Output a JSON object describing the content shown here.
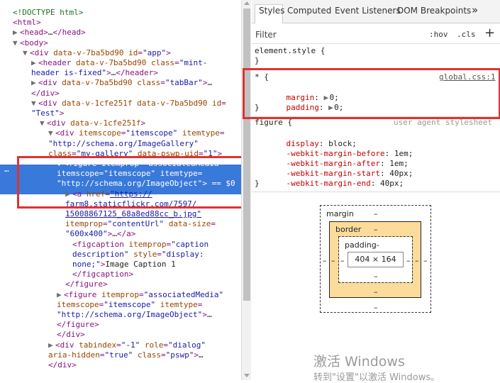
{
  "elements_tree": {
    "lines": [
      {
        "parts": [
          [
            "cmt",
            "<!DOCTYPE html>"
          ]
        ]
      },
      {
        "parts": [
          [
            "tag",
            "<html>"
          ]
        ]
      },
      {
        "parts": [
          [
            "tri",
            "▶"
          ],
          [
            "tag",
            "<head>"
          ],
          [
            "txt",
            "…"
          ],
          [
            "tag",
            "</head>"
          ]
        ]
      },
      {
        "parts": [
          [
            "tri",
            "▼"
          ],
          [
            "tag",
            "<body>"
          ]
        ]
      },
      {
        "parts": [
          [
            "tri",
            "▼"
          ],
          [
            "tag",
            "<div "
          ],
          [
            "attr",
            "data-v-7ba5bd90 id"
          ],
          [
            "tag",
            "="
          ],
          [
            "val",
            "\"app\""
          ],
          [
            "tag",
            ">"
          ]
        ]
      },
      {
        "parts": [
          [
            "tri",
            "▶"
          ],
          [
            "tag",
            "<header "
          ],
          [
            "attr",
            "data-v-7ba5bd90 class"
          ],
          [
            "tag",
            "="
          ],
          [
            "val",
            "\"mint-"
          ]
        ]
      },
      {
        "parts": [
          [
            "val",
            "header is-fixed\""
          ],
          [
            "tag",
            ">"
          ],
          [
            "txt",
            "…"
          ],
          [
            "tag",
            "</header>"
          ]
        ]
      },
      {
        "parts": [
          [
            "tri",
            "▶"
          ],
          [
            "tag",
            "<div "
          ],
          [
            "attr",
            "data-v-7ba5bd90 class"
          ],
          [
            "tag",
            "="
          ],
          [
            "val",
            "\"tabBar\""
          ],
          [
            "tag",
            ">"
          ],
          [
            "txt",
            "…"
          ]
        ]
      },
      {
        "parts": [
          [
            "tag",
            "</div>"
          ]
        ]
      },
      {
        "parts": [
          [
            "tri",
            "▼"
          ],
          [
            "tag",
            "<div "
          ],
          [
            "attr",
            "data-v-1cfe251f data-v-7ba5bd90 id"
          ],
          [
            "tag",
            "="
          ]
        ]
      },
      {
        "parts": [
          [
            "val",
            "\"Test\""
          ],
          [
            "tag",
            ">"
          ]
        ]
      },
      {
        "parts": [
          [
            "tri",
            "▼"
          ],
          [
            "tag",
            "<div "
          ],
          [
            "attr",
            "data-v-1cfe251f"
          ],
          [
            "tag",
            ">"
          ]
        ]
      },
      {
        "parts": [
          [
            "tri",
            "▼"
          ],
          [
            "tag",
            "<div "
          ],
          [
            "attr",
            "itemscope"
          ],
          [
            "tag",
            "="
          ],
          [
            "val",
            "\"itemscope\""
          ],
          [
            "attr",
            " itemtype"
          ],
          [
            "tag",
            "="
          ]
        ]
      },
      {
        "parts": [
          [
            "val",
            "\"http://schema.org/ImageGallery\""
          ]
        ]
      },
      {
        "parts": [
          [
            "attr",
            "class"
          ],
          [
            "tag",
            "="
          ],
          [
            "val",
            "\"my-gallery\""
          ],
          [
            "attr",
            " data-pswp-uid"
          ],
          [
            "tag",
            "="
          ],
          [
            "val",
            "\"1\""
          ],
          [
            "tag",
            ">"
          ]
        ]
      },
      {
        "parts": [
          [
            "tri",
            "▼"
          ],
          [
            "tag",
            "<figure "
          ],
          [
            "attr",
            "itemprop"
          ],
          [
            "tag",
            "="
          ],
          [
            "val",
            "\"associatedMedia\""
          ]
        ]
      },
      {
        "parts": [
          [
            "attr",
            "itemscope"
          ],
          [
            "tag",
            "="
          ],
          [
            "val",
            "\"itemscope\""
          ],
          [
            "attr",
            " itemtype"
          ],
          [
            "tag",
            "="
          ]
        ]
      },
      {
        "parts": [
          [
            "val",
            "\"http://schema.org/ImageObject\""
          ],
          [
            "tag",
            ">"
          ],
          [
            "txt",
            " == $0"
          ]
        ]
      },
      {
        "parts": [
          [
            "tri",
            "▶"
          ],
          [
            "tag",
            "<a "
          ],
          [
            "attr",
            "href"
          ],
          [
            "tag",
            "="
          ],
          [
            "link",
            "\"https://"
          ]
        ]
      },
      {
        "parts": [
          [
            "link",
            "farm8.staticflickr.com/7597/"
          ]
        ]
      },
      {
        "parts": [
          [
            "link",
            "15008867125_68a8ed88cc_b.jpg\""
          ]
        ]
      },
      {
        "parts": [
          [
            "attr",
            "itemprop"
          ],
          [
            "tag",
            "="
          ],
          [
            "val",
            "\"contentUrl\""
          ],
          [
            "attr",
            " data-size"
          ],
          [
            "tag",
            "="
          ]
        ]
      },
      {
        "parts": [
          [
            "val",
            "\"600x400\""
          ],
          [
            "tag",
            ">"
          ],
          [
            "txt",
            "…"
          ],
          [
            "tag",
            "</a>"
          ]
        ]
      },
      {
        "parts": [
          [
            "tag",
            "<figcaption "
          ],
          [
            "attr",
            "itemprop"
          ],
          [
            "tag",
            "="
          ],
          [
            "val",
            "\"caption"
          ]
        ]
      },
      {
        "parts": [
          [
            "val",
            "description\""
          ],
          [
            "attr",
            " style"
          ],
          [
            "tag",
            "="
          ],
          [
            "val",
            "\"display:"
          ]
        ]
      },
      {
        "parts": [
          [
            "val",
            "none;\""
          ],
          [
            "tag",
            ">"
          ],
          [
            "txt",
            "Image Caption 1"
          ]
        ]
      },
      {
        "parts": [
          [
            "tag",
            "</figcaption>"
          ]
        ]
      },
      {
        "parts": [
          [
            "tag",
            "</figure>"
          ]
        ]
      },
      {
        "parts": [
          [
            "tri",
            "▶"
          ],
          [
            "tag",
            "<figure "
          ],
          [
            "attr",
            "itemprop"
          ],
          [
            "tag",
            "="
          ],
          [
            "val",
            "\"associatedMedia\""
          ]
        ]
      },
      {
        "parts": [
          [
            "attr",
            "itemscope"
          ],
          [
            "tag",
            "="
          ],
          [
            "val",
            "\"itemscope\""
          ],
          [
            "attr",
            " itemtype"
          ],
          [
            "tag",
            "="
          ]
        ]
      },
      {
        "parts": [
          [
            "val",
            "\"http://schema.org/ImageObject\""
          ],
          [
            "tag",
            ">"
          ],
          [
            "txt",
            "…"
          ]
        ]
      },
      {
        "parts": [
          [
            "tag",
            "</figure>"
          ]
        ]
      },
      {
        "parts": [
          [
            "tag",
            "</div>"
          ]
        ]
      },
      {
        "parts": [
          [
            "tri",
            "▶"
          ],
          [
            "tag",
            "<div "
          ],
          [
            "attr",
            "tabindex"
          ],
          [
            "tag",
            "="
          ],
          [
            "val",
            "\"-1\""
          ],
          [
            "attr",
            " role"
          ],
          [
            "tag",
            "="
          ],
          [
            "val",
            "\"dialog\""
          ]
        ]
      },
      {
        "parts": [
          [
            "attr",
            "aria-hidden"
          ],
          [
            "tag",
            "="
          ],
          [
            "val",
            "\"true\""
          ],
          [
            "attr",
            " class"
          ],
          [
            "tag",
            "="
          ],
          [
            "val",
            "\"pswp\""
          ],
          [
            "tag",
            ">"
          ],
          [
            "txt",
            "…"
          ]
        ]
      },
      {
        "parts": [
          [
            "tag",
            "</div>"
          ]
        ]
      }
    ],
    "selected_dots": "…"
  },
  "styles_panel": {
    "tabs": [
      "Styles",
      "Computed",
      "Event Listeners",
      "DOM Breakpoints"
    ],
    "more_tabs": "»",
    "filter_placeholder": "Filter",
    "hov": ":hov",
    "cls": ".cls",
    "add": "+",
    "element_style_open": "element.style {",
    "element_style_close": "}",
    "universal_selector": "* {",
    "universal_source": "global.css:1",
    "universal_props": [
      {
        "name": "margin",
        "value": "0;"
      },
      {
        "name": "padding",
        "value": "0;"
      }
    ],
    "universal_close": "}",
    "figure_selector": "figure {",
    "figure_source": "user agent stylesheet",
    "figure_props": [
      {
        "name": "display",
        "value": "block;"
      },
      {
        "name": "-webkit-margin-before",
        "value": "1em;"
      },
      {
        "name": "-webkit-margin-after",
        "value": "1em;"
      },
      {
        "name": "-webkit-margin-start",
        "value": "40px;"
      },
      {
        "name": "-webkit-margin-end",
        "value": "40px;"
      }
    ],
    "figure_close": "}"
  },
  "box_model": {
    "margin_label": "margin",
    "border_label": "border",
    "padding_label": "padding-",
    "content_size": "404 × 164",
    "dash": "–"
  },
  "watermark": {
    "line1": "激活 Windows",
    "line2": "转到\"设置\"以激活 Windows。"
  },
  "colors": {
    "selection": "#3879d9",
    "highlight_box": "#e03232",
    "border_box": "#fddb9a",
    "padding_box": "#c6d48c"
  }
}
